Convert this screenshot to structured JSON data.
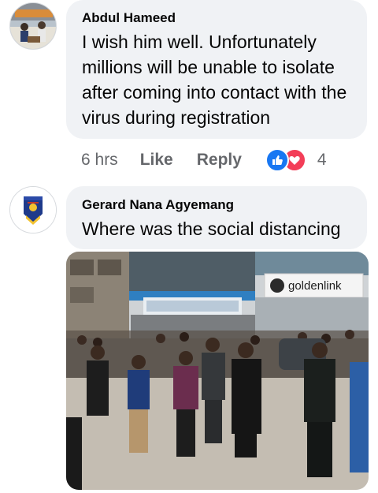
{
  "comments": [
    {
      "author": "Abdul Hameed",
      "text": "I wish him well. Unfortunately millions will be unable to isolate after coming into contact with the virus during registration",
      "time": "6 hrs",
      "like_label": "Like",
      "reply_label": "Reply",
      "reaction_count": "4",
      "reaction_icons": [
        "like-icon",
        "love-icon"
      ]
    },
    {
      "author": "Gerard Nana Agyemang",
      "text": "Where was the social distancing",
      "avatar_icon": "school-crest-icon",
      "photo": {
        "shop_sign": "goldenlink",
        "icon": "crowd-photo"
      }
    }
  ],
  "colors": {
    "bubble": "#f0f2f5",
    "meta_text": "#65676b",
    "like_blue": "#1877f2",
    "love_red": "#f33e58"
  }
}
